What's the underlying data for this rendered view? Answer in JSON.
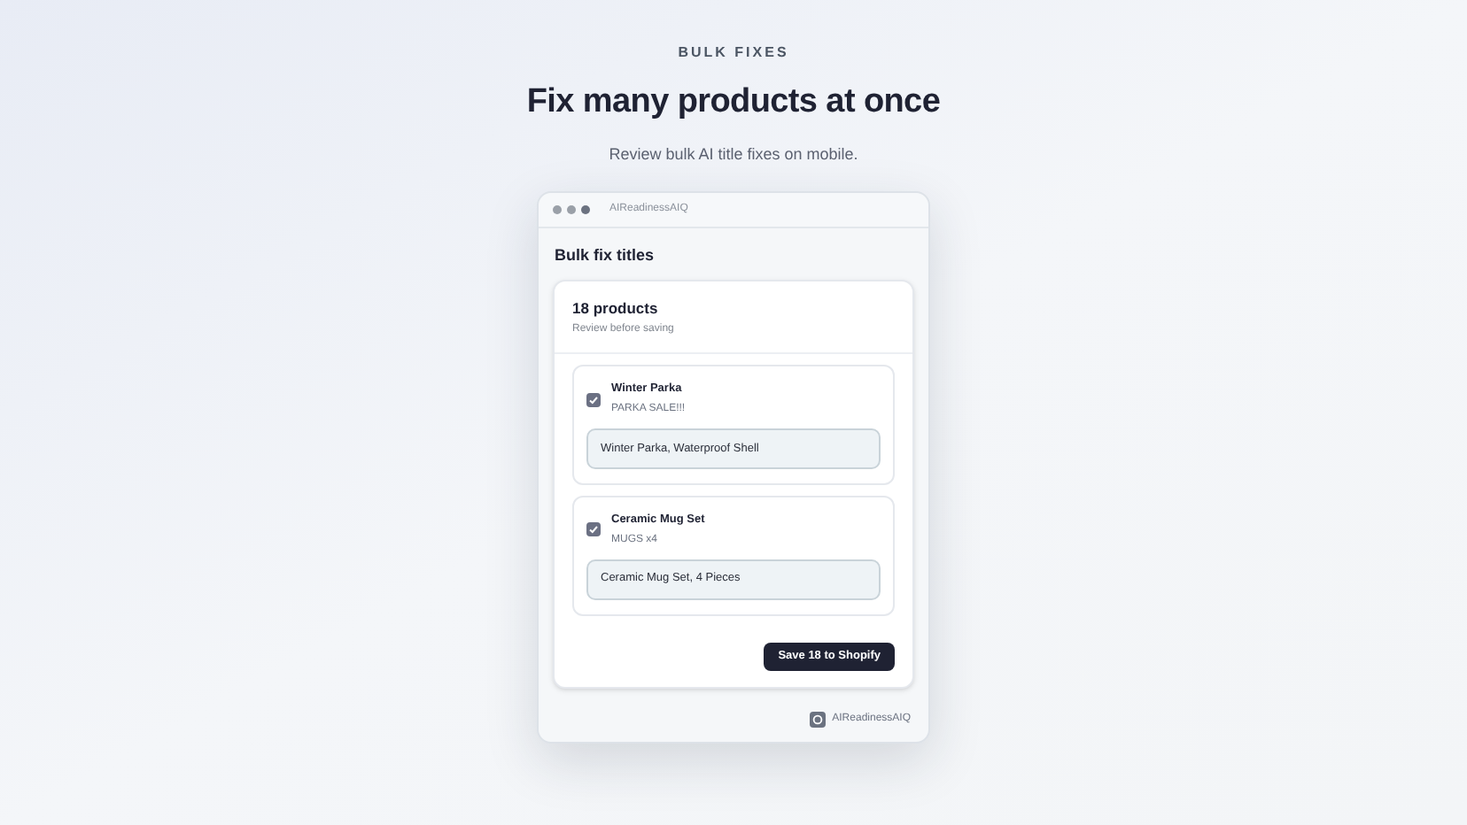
{
  "eyebrow": "BULK FIXES",
  "headline": "Fix many products at once",
  "subtitle": "Review bulk AI title fixes on mobile.",
  "window": {
    "title": "AIReadinessAIQ",
    "heading": "Bulk fix titles",
    "card": {
      "count": "18 products",
      "note": "Review before saving",
      "products": [
        {
          "name": "Winter Parka",
          "original": "PARKA SALE!!!",
          "checked": true,
          "suggestion": "Winter Parka, Waterproof Shell"
        },
        {
          "name": "Ceramic Mug Set",
          "original": "MUGS x4",
          "checked": true,
          "suggestion": "Ceramic Mug Set, 4 Pieces"
        }
      ],
      "button": "Save 18 to Shopify"
    },
    "footer": "AIReadinessAIQ"
  }
}
